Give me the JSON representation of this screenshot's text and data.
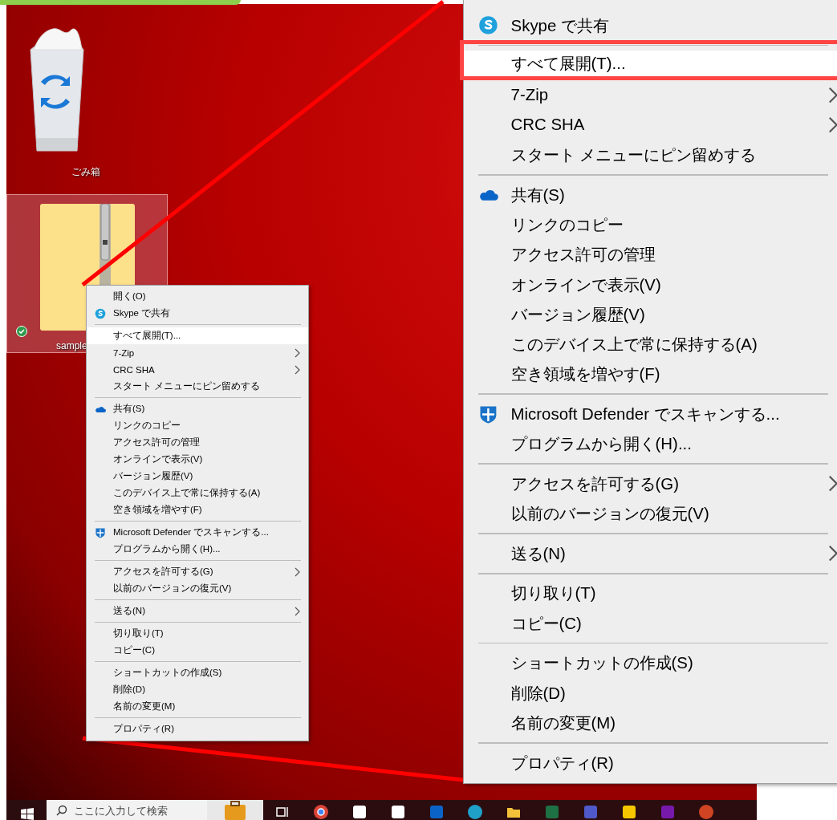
{
  "desktop": {
    "icons": [
      {
        "kind": "recycle-bin",
        "label": "ごみ箱",
        "selected": false,
        "synced": false
      },
      {
        "kind": "zip-folder",
        "label": "sample",
        "selected": true,
        "synced": true
      }
    ]
  },
  "context_menu": {
    "items": [
      {
        "kind": "item",
        "label": "開く(O)",
        "submenu": false,
        "selected": false
      },
      {
        "kind": "item",
        "label": "Skype で共有",
        "submenu": false,
        "selected": false
      },
      {
        "kind": "separator"
      },
      {
        "kind": "item",
        "label": "すべて展開(T)...",
        "submenu": false,
        "selected": true
      },
      {
        "kind": "item",
        "label": "7-Zip",
        "submenu": true,
        "selected": false
      },
      {
        "kind": "item",
        "label": "CRC SHA",
        "submenu": true,
        "selected": false
      },
      {
        "kind": "item",
        "label": "スタート メニューにピン留めする",
        "submenu": false,
        "selected": false
      },
      {
        "kind": "separator"
      },
      {
        "kind": "item",
        "label": "共有(S)",
        "submenu": false,
        "selected": false
      },
      {
        "kind": "item",
        "label": "リンクのコピー",
        "submenu": false,
        "selected": false
      },
      {
        "kind": "item",
        "label": "アクセス許可の管理",
        "submenu": false,
        "selected": false
      },
      {
        "kind": "item",
        "label": "オンラインで表示(V)",
        "submenu": false,
        "selected": false
      },
      {
        "kind": "item",
        "label": "バージョン履歴(V)",
        "submenu": false,
        "selected": false
      },
      {
        "kind": "item",
        "label": "このデバイス上で常に保持する(A)",
        "submenu": false,
        "selected": false
      },
      {
        "kind": "item",
        "label": "空き領域を増やす(F)",
        "submenu": false,
        "selected": false
      },
      {
        "kind": "separator"
      },
      {
        "kind": "item",
        "label": "Microsoft Defender でスキャンする...",
        "submenu": false,
        "selected": false
      },
      {
        "kind": "item",
        "label": "プログラムから開く(H)...",
        "submenu": false,
        "selected": false
      },
      {
        "kind": "separator"
      },
      {
        "kind": "item",
        "label": "アクセスを許可する(G)",
        "submenu": true,
        "selected": false
      },
      {
        "kind": "item",
        "label": "以前のバージョンの復元(V)",
        "submenu": false,
        "selected": false
      },
      {
        "kind": "separator"
      },
      {
        "kind": "item",
        "label": "送る(N)",
        "submenu": true,
        "selected": false
      },
      {
        "kind": "separator"
      },
      {
        "kind": "item",
        "label": "切り取り(T)",
        "submenu": false,
        "selected": false
      },
      {
        "kind": "item",
        "label": "コピー(C)",
        "submenu": false,
        "selected": false
      },
      {
        "kind": "separator"
      },
      {
        "kind": "item",
        "label": "ショートカットの作成(S)",
        "submenu": false,
        "selected": false
      },
      {
        "kind": "item",
        "label": "削除(D)",
        "submenu": false,
        "selected": false
      },
      {
        "kind": "item",
        "label": "名前の変更(M)",
        "submenu": false,
        "selected": false
      },
      {
        "kind": "separator"
      },
      {
        "kind": "item",
        "label": "プロパティ(R)",
        "submenu": false,
        "selected": false
      }
    ]
  },
  "magnified_menu": {
    "items": [
      {
        "kind": "item",
        "label": "Skype で共有",
        "submenu": false,
        "selected": false,
        "callout": false
      },
      {
        "kind": "separator"
      },
      {
        "kind": "item",
        "label": "すべて展開(T)...",
        "submenu": false,
        "selected": true,
        "callout": true
      },
      {
        "kind": "item",
        "label": "7-Zip",
        "submenu": true,
        "selected": false,
        "callout": false
      },
      {
        "kind": "item",
        "label": "CRC SHA",
        "submenu": true,
        "selected": false,
        "callout": false
      },
      {
        "kind": "item",
        "label": "スタート メニューにピン留めする",
        "submenu": false,
        "selected": false,
        "callout": false
      },
      {
        "kind": "separator"
      },
      {
        "kind": "item",
        "label": "共有(S)",
        "submenu": false,
        "selected": false,
        "callout": false
      },
      {
        "kind": "item",
        "label": "リンクのコピー",
        "submenu": false,
        "selected": false,
        "callout": false
      },
      {
        "kind": "item",
        "label": "アクセス許可の管理",
        "submenu": false,
        "selected": false,
        "callout": false
      },
      {
        "kind": "item",
        "label": "オンラインで表示(V)",
        "submenu": false,
        "selected": false,
        "callout": false
      },
      {
        "kind": "item",
        "label": "バージョン履歴(V)",
        "submenu": false,
        "selected": false,
        "callout": false
      },
      {
        "kind": "item",
        "label": "このデバイス上で常に保持する(A)",
        "submenu": false,
        "selected": false,
        "callout": false
      },
      {
        "kind": "item",
        "label": "空き領域を増やす(F)",
        "submenu": false,
        "selected": false,
        "callout": false
      },
      {
        "kind": "separator"
      },
      {
        "kind": "item",
        "label": "Microsoft Defender でスキャンする...",
        "submenu": false,
        "selected": false,
        "callout": false
      },
      {
        "kind": "item",
        "label": "プログラムから開く(H)...",
        "submenu": false,
        "selected": false,
        "callout": false
      },
      {
        "kind": "separator"
      },
      {
        "kind": "item",
        "label": "アクセスを許可する(G)",
        "submenu": true,
        "selected": false,
        "callout": false
      },
      {
        "kind": "item",
        "label": "以前のバージョンの復元(V)",
        "submenu": false,
        "selected": false,
        "callout": false
      },
      {
        "kind": "separator"
      },
      {
        "kind": "item",
        "label": "送る(N)",
        "submenu": true,
        "selected": false,
        "callout": false
      },
      {
        "kind": "separator"
      },
      {
        "kind": "item",
        "label": "切り取り(T)",
        "submenu": false,
        "selected": false,
        "callout": false
      },
      {
        "kind": "item",
        "label": "コピー(C)",
        "submenu": false,
        "selected": false,
        "callout": false
      },
      {
        "kind": "separator"
      },
      {
        "kind": "item",
        "label": "ショートカットの作成(S)",
        "submenu": false,
        "selected": false,
        "callout": false
      },
      {
        "kind": "item",
        "label": "削除(D)",
        "submenu": false,
        "selected": false,
        "callout": false
      },
      {
        "kind": "item",
        "label": "名前の変更(M)",
        "submenu": false,
        "selected": false,
        "callout": false
      },
      {
        "kind": "separator"
      },
      {
        "kind": "item",
        "label": "プロパティ(R)",
        "submenu": false,
        "selected": false,
        "callout": false
      }
    ]
  },
  "taskbar": {
    "search": {
      "placeholder": "ここに入力して検索"
    }
  }
}
